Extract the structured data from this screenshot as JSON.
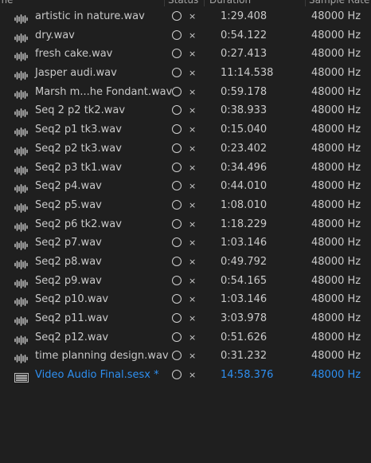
{
  "header": {
    "name": "ame",
    "sort_indicator": "▲",
    "status": "Status",
    "duration": "Duration",
    "sample_rate": "Sample Rate"
  },
  "status_x_glyph": "×",
  "files": [
    {
      "name": "artistic in nature.wav",
      "duration": "1:29.408",
      "rate": "48000 Hz",
      "icon": "waveform-icon",
      "type": "audio"
    },
    {
      "name": "dry.wav",
      "duration": "0:54.122",
      "rate": "48000 Hz",
      "icon": "waveform-icon",
      "type": "audio"
    },
    {
      "name": "fresh cake.wav",
      "duration": "0:27.413",
      "rate": "48000 Hz",
      "icon": "waveform-icon",
      "type": "audio"
    },
    {
      "name": "Jasper audi.wav",
      "duration": "11:14.538",
      "rate": "48000 Hz",
      "icon": "waveform-icon",
      "type": "audio"
    },
    {
      "name": "Marsh m...he Fondant.wav",
      "duration": "0:59.178",
      "rate": "48000 Hz",
      "icon": "waveform-icon",
      "type": "audio"
    },
    {
      "name": "Seq 2 p2 tk2.wav",
      "duration": "0:38.933",
      "rate": "48000 Hz",
      "icon": "waveform-icon",
      "type": "audio"
    },
    {
      "name": "Seq2 p1 tk3.wav",
      "duration": "0:15.040",
      "rate": "48000 Hz",
      "icon": "waveform-icon",
      "type": "audio"
    },
    {
      "name": "Seq2 p2 tk3.wav",
      "duration": "0:23.402",
      "rate": "48000 Hz",
      "icon": "waveform-icon",
      "type": "audio"
    },
    {
      "name": "Seq2 p3 tk1.wav",
      "duration": "0:34.496",
      "rate": "48000 Hz",
      "icon": "waveform-icon",
      "type": "audio"
    },
    {
      "name": "Seq2 p4.wav",
      "duration": "0:44.010",
      "rate": "48000 Hz",
      "icon": "waveform-icon",
      "type": "audio"
    },
    {
      "name": "Seq2 p5.wav",
      "duration": "1:08.010",
      "rate": "48000 Hz",
      "icon": "waveform-icon",
      "type": "audio"
    },
    {
      "name": "Seq2 p6 tk2.wav",
      "duration": "1:18.229",
      "rate": "48000 Hz",
      "icon": "waveform-icon",
      "type": "audio"
    },
    {
      "name": "Seq2 p7.wav",
      "duration": "1:03.146",
      "rate": "48000 Hz",
      "icon": "waveform-icon",
      "type": "audio"
    },
    {
      "name": "Seq2 p8.wav",
      "duration": "0:49.792",
      "rate": "48000 Hz",
      "icon": "waveform-icon",
      "type": "audio"
    },
    {
      "name": "Seq2 p9.wav",
      "duration": "0:54.165",
      "rate": "48000 Hz",
      "icon": "waveform-icon",
      "type": "audio"
    },
    {
      "name": "Seq2 p10.wav",
      "duration": "1:03.146",
      "rate": "48000 Hz",
      "icon": "waveform-icon",
      "type": "audio"
    },
    {
      "name": "Seq2 p11.wav",
      "duration": "3:03.978",
      "rate": "48000 Hz",
      "icon": "waveform-icon",
      "type": "audio"
    },
    {
      "name": "Seq2 p12.wav",
      "duration": "0:51.626",
      "rate": "48000 Hz",
      "icon": "waveform-icon",
      "type": "audio"
    },
    {
      "name": "time planning design.wav",
      "duration": "0:31.232",
      "rate": "48000 Hz",
      "icon": "waveform-icon",
      "type": "audio"
    },
    {
      "name": "Video Audio Final.sesx *",
      "duration": "14:58.376",
      "rate": "48000 Hz",
      "icon": "multitrack-session-icon",
      "type": "session"
    }
  ],
  "colors": {
    "background": "#1f1f1f",
    "text": "#c9c9c9",
    "header_text": "#a5a5a5",
    "session_accent": "#2e8ff0"
  }
}
